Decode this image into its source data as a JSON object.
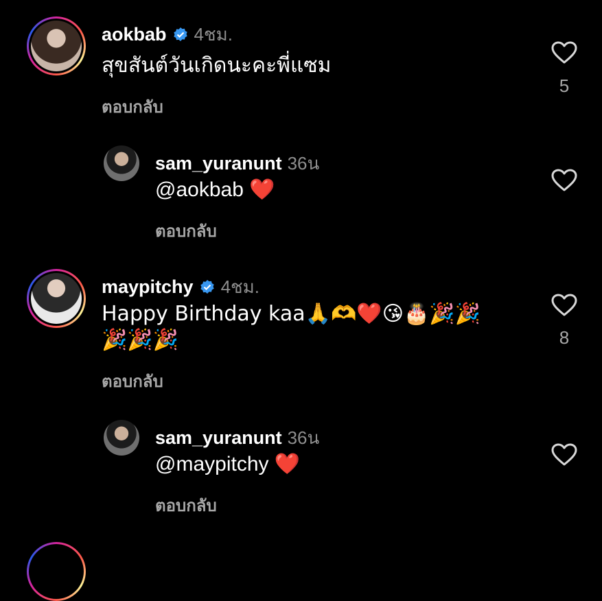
{
  "comments": [
    {
      "username": "aokbab",
      "time": "4ชม.",
      "text": "สุขสันต์วันเกิดนะคะพี่แซม",
      "reply_label": "ตอบกลับ",
      "likes": "5",
      "verified": true
    },
    {
      "username": "sam_yuranunt",
      "time": "36น",
      "text": "@aokbab",
      "text_emoji": "❤️",
      "reply_label": "ตอบกลับ"
    },
    {
      "username": "maypitchy",
      "time": "4ชม.",
      "text_line1": "Happy Birthday kaa🙏🫶❤️😘🎂🎉🎉",
      "text_line2": "🎉🎉🎉",
      "reply_label": "ตอบกลับ",
      "likes": "8",
      "verified": true
    },
    {
      "username": "sam_yuranunt",
      "time": "36น",
      "text": "@maypitchy",
      "text_emoji": "❤️",
      "reply_label": "ตอบกลับ"
    }
  ],
  "icons": {
    "like": "heart-outline-icon",
    "verified": "verified-badge-icon"
  },
  "colors": {
    "background": "#000000",
    "secondary_text": "#8e8e8e",
    "verified_blue": "#3897f0",
    "heart_red": "#e0182d"
  }
}
